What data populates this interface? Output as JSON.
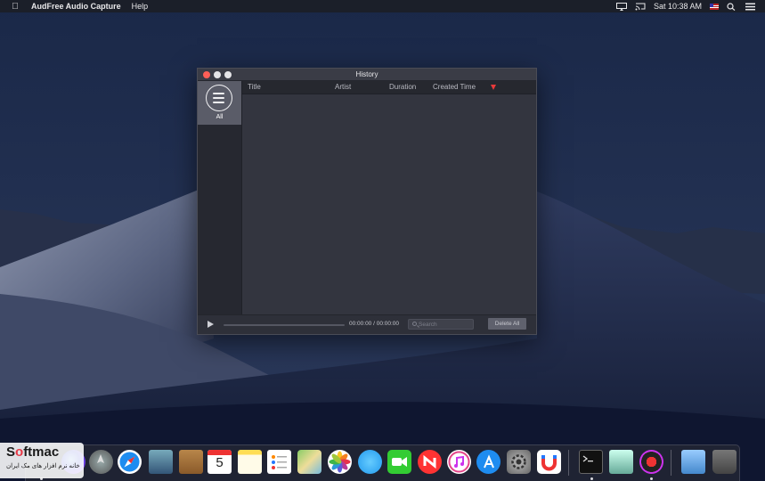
{
  "menubar": {
    "app_name": "AudFree Audio Capture",
    "menus": [
      "Help"
    ],
    "clock": "Sat 10:38 AM",
    "icons": [
      "apple-icon",
      "airplay-icon",
      "cast-icon",
      "flag-us-icon",
      "search-icon",
      "list-icon"
    ]
  },
  "window": {
    "title": "History",
    "sidebar": {
      "items": [
        {
          "label": "All",
          "icon": "list-circle-icon"
        }
      ]
    },
    "table": {
      "columns": [
        "Title",
        "Artist",
        "Duration",
        "Created Time"
      ],
      "sort_indicator": "sort-down-icon",
      "rows": []
    },
    "player": {
      "time_display": "00:00:00 / 00:00:00",
      "search_placeholder": "Search",
      "delete_all_label": "Delete All"
    }
  },
  "watermark": {
    "logo_a": "S",
    "logo_b": "o",
    "logo_c": "ftmac",
    "subtitle": "خانه نرم افزار های مک ایران"
  },
  "dock": {
    "apps": [
      "finder",
      "siri",
      "launchpad",
      "safari",
      "mail",
      "contacts",
      "calendar",
      "notes",
      "reminders",
      "maps",
      "photos",
      "messages",
      "facetime",
      "news",
      "itunes",
      "app-store",
      "system-preferences",
      "magnet",
      "terminal",
      "preview",
      "audfree-audio-capture",
      "downloads-folder",
      "trash"
    ],
    "calendar_day": "5",
    "colors": {
      "accent_red": "#e83a3a",
      "window_bg": "#2b2d36"
    }
  }
}
